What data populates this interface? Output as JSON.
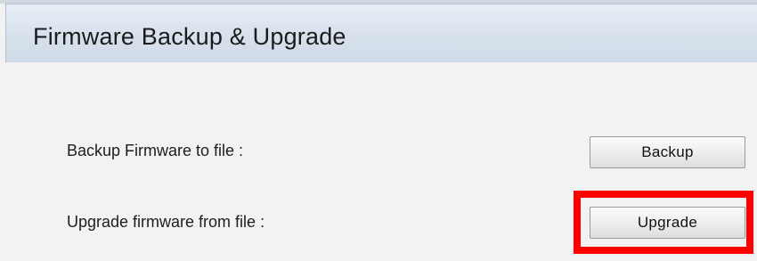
{
  "page": {
    "title": "Firmware Backup & Upgrade"
  },
  "rows": [
    {
      "label": "Backup Firmware to file :",
      "button_label": "Backup"
    },
    {
      "label": "Upgrade firmware from file :",
      "button_label": "Upgrade"
    }
  ],
  "colors": {
    "highlight": "#ff0000",
    "header_background": "#d7e1ec",
    "panel_background": "#f2f2f2"
  }
}
